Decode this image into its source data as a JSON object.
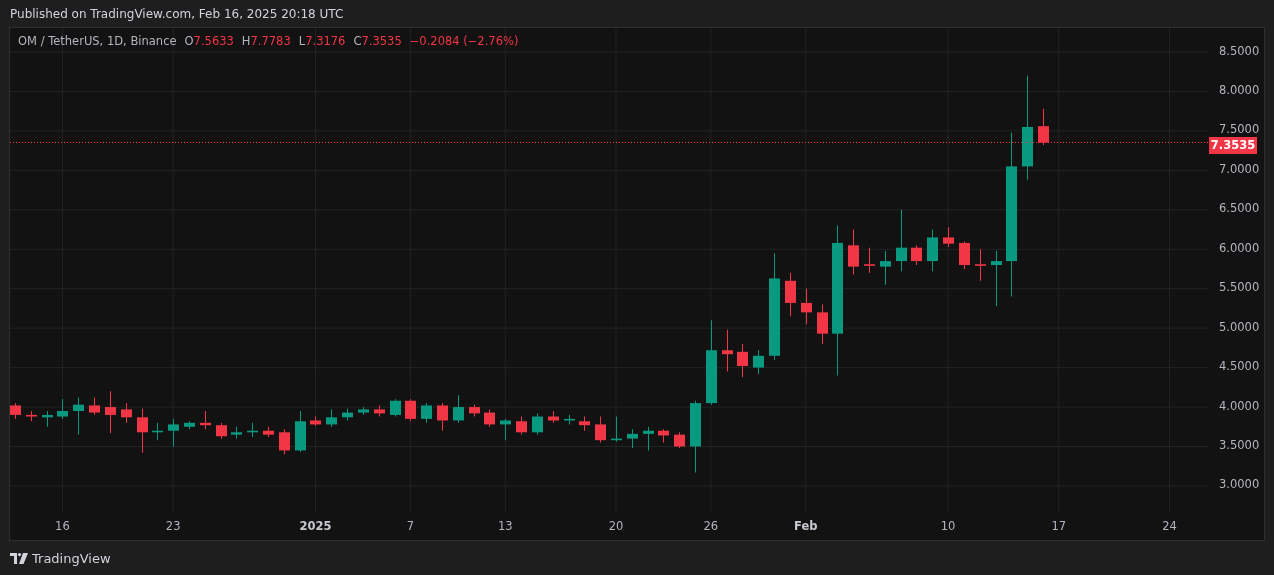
{
  "published": "Published on TradingView.com, Feb 16, 2025 20:18 UTC",
  "legend": {
    "symbol": "OM / TetherUS, 1D, Binance",
    "falling": true,
    "values": [
      {
        "label": "O",
        "value": "7.5633"
      },
      {
        "label": "H",
        "value": "7.7783"
      },
      {
        "label": "L",
        "value": "7.3176"
      },
      {
        "label": "C",
        "value": "7.3535"
      }
    ],
    "change": "−0.2084 (−2.76%)"
  },
  "price_axis": [
    "8.5000",
    "8.0000",
    "7.5000",
    "7.0000",
    "6.5000",
    "6.0000",
    "5.5000",
    "5.0000",
    "4.5000",
    "4.0000",
    "3.5000",
    "3.0000"
  ],
  "last_price": {
    "value": "7.3535",
    "falling": true
  },
  "time_axis": [
    {
      "label": "16",
      "kind": "day"
    },
    {
      "label": "23",
      "kind": "day"
    },
    {
      "label": "2025",
      "kind": "year"
    },
    {
      "label": "7",
      "kind": "day"
    },
    {
      "label": "13",
      "kind": "day"
    },
    {
      "label": "20",
      "kind": "day"
    },
    {
      "label": "26",
      "kind": "day"
    },
    {
      "label": "Feb",
      "kind": "month"
    },
    {
      "label": "10",
      "kind": "day"
    },
    {
      "label": "17",
      "kind": "day"
    },
    {
      "label": "24",
      "kind": "day"
    }
  ],
  "footer": {
    "brand": "TradingView"
  }
}
